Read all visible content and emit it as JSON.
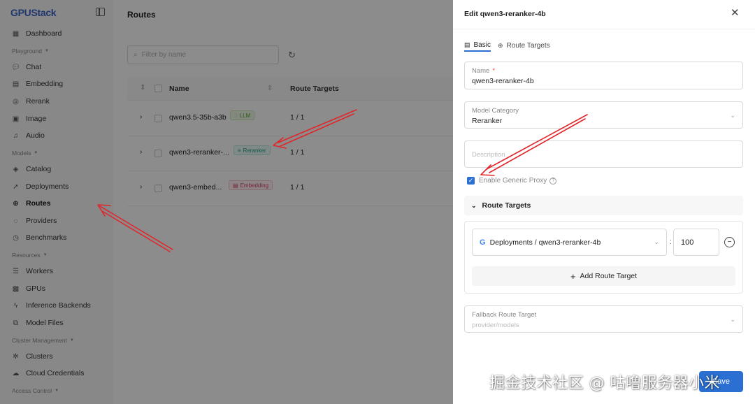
{
  "app": {
    "logo": "GPUStack"
  },
  "sidebar": {
    "items": [
      {
        "label": "Dashboard",
        "icon": "grid-icon"
      },
      {
        "section": "Playground"
      },
      {
        "label": "Chat",
        "icon": "chat-icon"
      },
      {
        "label": "Embedding",
        "icon": "embedding-icon"
      },
      {
        "label": "Rerank",
        "icon": "rerank-icon"
      },
      {
        "label": "Image",
        "icon": "image-icon"
      },
      {
        "label": "Audio",
        "icon": "audio-icon"
      },
      {
        "section": "Models"
      },
      {
        "label": "Catalog",
        "icon": "layers-icon"
      },
      {
        "label": "Deployments",
        "icon": "rocket-icon"
      },
      {
        "label": "Routes",
        "icon": "routes-icon",
        "active": true
      },
      {
        "label": "Providers",
        "icon": "providers-icon"
      },
      {
        "label": "Benchmarks",
        "icon": "benchmark-icon"
      },
      {
        "section": "Resources"
      },
      {
        "label": "Workers",
        "icon": "server-icon"
      },
      {
        "label": "GPUs",
        "icon": "chip-icon"
      },
      {
        "label": "Inference Backends",
        "icon": "bolt-icon"
      },
      {
        "label": "Model Files",
        "icon": "files-icon"
      },
      {
        "section": "Cluster Management"
      },
      {
        "label": "Clusters",
        "icon": "cluster-icon"
      },
      {
        "label": "Cloud Credentials",
        "icon": "cloud-icon"
      },
      {
        "section": "Access Control"
      }
    ]
  },
  "main": {
    "title": "Routes",
    "filter_placeholder": "Filter by name",
    "columns": {
      "name": "Name",
      "targets": "Route Targets"
    },
    "rows": [
      {
        "name": "qwen3.5-35b-a3b",
        "tag": "LLM",
        "tag_type": "llm",
        "targets": "1 / 1"
      },
      {
        "name": "qwen3-reranker-...",
        "tag": "Reranker",
        "tag_type": "rerank",
        "targets": "1 / 1"
      },
      {
        "name": "qwen3-embed...",
        "tag": "Embedding",
        "tag_type": "embed",
        "targets": "1 / 1"
      }
    ]
  },
  "drawer": {
    "title": "Edit qwen3-reranker-4b",
    "tabs": [
      {
        "label": "Basic",
        "active": true
      },
      {
        "label": "Route Targets"
      }
    ],
    "name_label": "Name",
    "name_required": "*",
    "name_value": "qwen3-reranker-4b",
    "category_label": "Model Category",
    "category_value": "Reranker",
    "description_label": "Description",
    "generic_proxy_label": "Enable Generic Proxy",
    "generic_proxy_checked": true,
    "route_targets_section": "Route Targets",
    "target_select_value": "Deployments / qwen3-reranker-4b",
    "target_weight": "100",
    "add_target_label": "Add Route Target",
    "fallback_label": "Fallback Route Target",
    "fallback_placeholder": "provider/models",
    "save_label": "Save"
  },
  "watermark": "掘金技术社区 @ 咕噜服务器小米",
  "colors": {
    "accent": "#2a6fd1",
    "annotation_arrow": "#e0262b",
    "logo": "#3b63c9"
  }
}
